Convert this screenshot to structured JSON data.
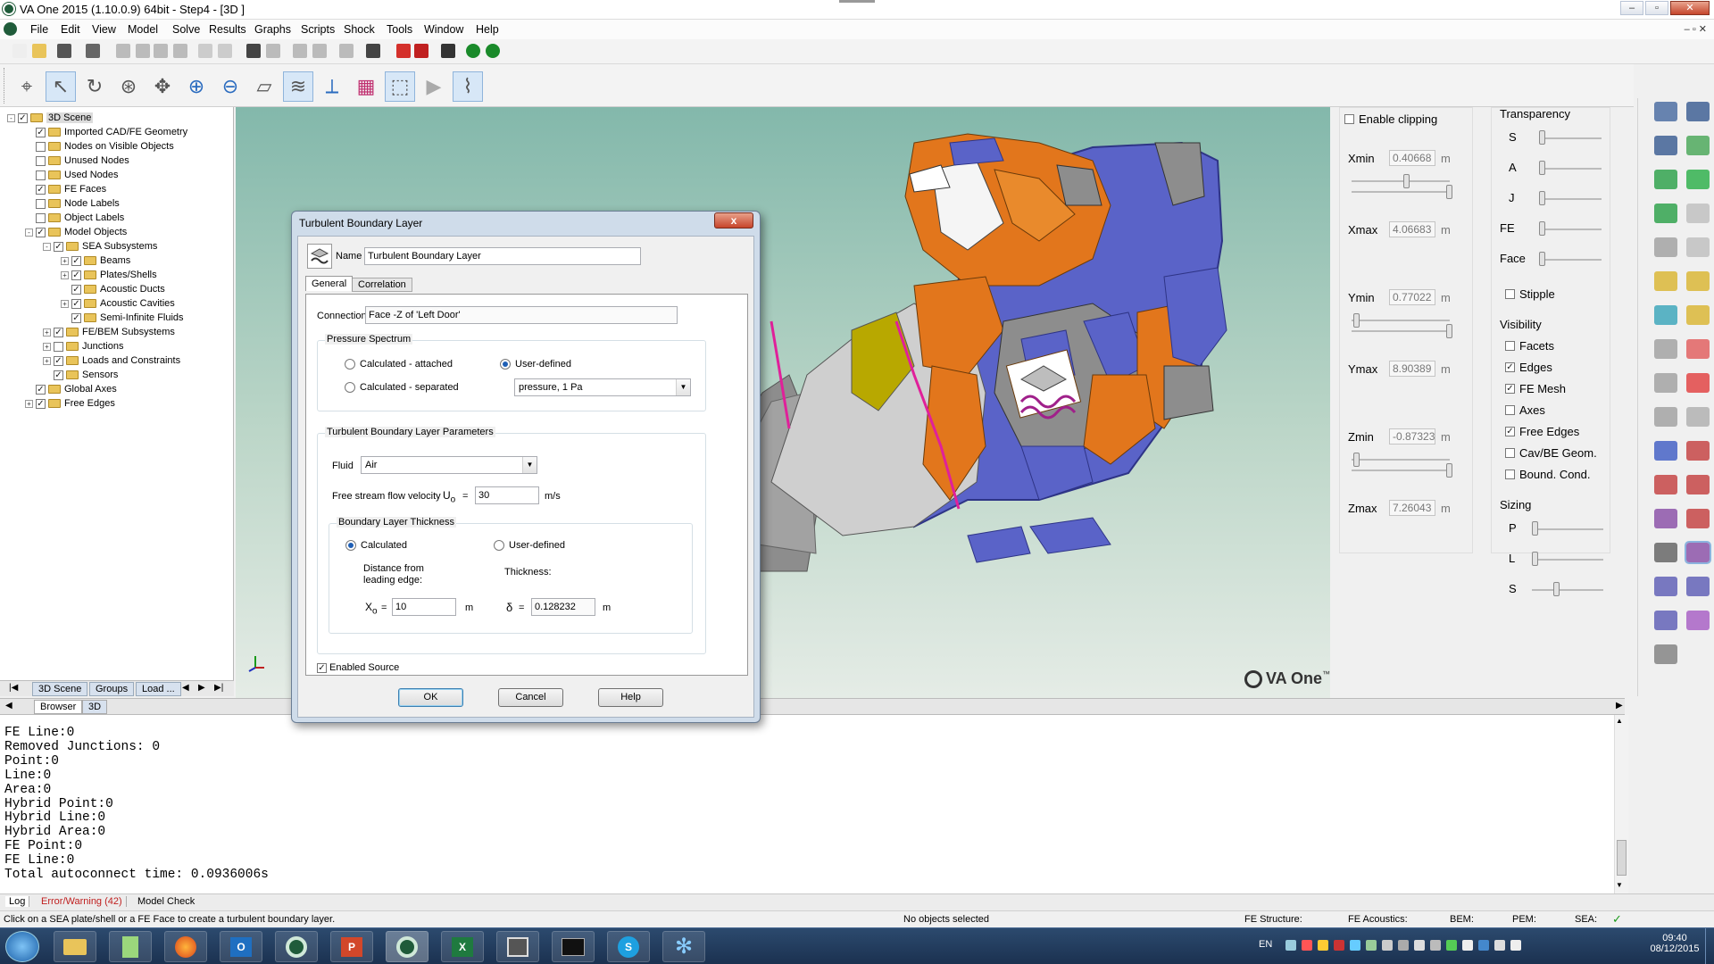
{
  "window": {
    "title": "VA One 2015 (1.10.0.9) 64bit - Step4 - [3D ]"
  },
  "menu": [
    "File",
    "Edit",
    "View",
    "Model",
    "Solve",
    "Results",
    "Graphs",
    "Scripts",
    "Shock",
    "Tools",
    "Window",
    "Help"
  ],
  "tree": {
    "items": [
      {
        "label": "3D Scene",
        "level": 0,
        "checked": true,
        "expand": "-"
      },
      {
        "label": "Imported CAD/FE Geometry",
        "level": 1,
        "checked": true,
        "expand": ""
      },
      {
        "label": "Nodes on Visible Objects",
        "level": 1,
        "checked": false,
        "expand": ""
      },
      {
        "label": "Unused Nodes",
        "level": 1,
        "checked": false,
        "expand": ""
      },
      {
        "label": "Used Nodes",
        "level": 1,
        "checked": false,
        "expand": ""
      },
      {
        "label": "FE Faces",
        "level": 1,
        "checked": true,
        "expand": ""
      },
      {
        "label": "Node Labels",
        "level": 1,
        "checked": false,
        "expand": ""
      },
      {
        "label": "Object Labels",
        "level": 1,
        "checked": false,
        "expand": ""
      },
      {
        "label": "Model Objects",
        "level": 1,
        "checked": true,
        "expand": "-"
      },
      {
        "label": "SEA Subsystems",
        "level": 2,
        "checked": true,
        "expand": "-"
      },
      {
        "label": "Beams",
        "level": 3,
        "checked": true,
        "expand": "+"
      },
      {
        "label": "Plates/Shells",
        "level": 3,
        "checked": true,
        "expand": "+"
      },
      {
        "label": "Acoustic Ducts",
        "level": 3,
        "checked": true,
        "expand": ""
      },
      {
        "label": "Acoustic Cavities",
        "level": 3,
        "checked": true,
        "expand": "+"
      },
      {
        "label": "Semi-Infinite Fluids",
        "level": 3,
        "checked": true,
        "expand": ""
      },
      {
        "label": "FE/BEM Subsystems",
        "level": 2,
        "checked": true,
        "expand": "+"
      },
      {
        "label": "Junctions",
        "level": 2,
        "checked": false,
        "expand": "+"
      },
      {
        "label": "Loads and Constraints",
        "level": 2,
        "checked": true,
        "expand": "+"
      },
      {
        "label": "Sensors",
        "level": 2,
        "checked": true,
        "expand": ""
      },
      {
        "label": "Global Axes",
        "level": 1,
        "checked": true,
        "expand": ""
      },
      {
        "label": "Free Edges",
        "level": 1,
        "checked": true,
        "expand": "+"
      }
    ],
    "tabs": [
      "3D Scene",
      "Groups",
      "Load ..."
    ]
  },
  "clipping": {
    "enable_label": "Enable clipping",
    "fields": [
      {
        "label": "Xmin",
        "value": "0.40668",
        "unit": "m"
      },
      {
        "label": "Xmax",
        "value": "4.06683",
        "unit": "m"
      },
      {
        "label": "Ymin",
        "value": "0.77022",
        "unit": "m"
      },
      {
        "label": "Ymax",
        "value": "8.90389",
        "unit": "m"
      },
      {
        "label": "Zmin",
        "value": "-0.87323",
        "unit": "m"
      },
      {
        "label": "Zmax",
        "value": "7.26043",
        "unit": "m"
      }
    ]
  },
  "transparency": {
    "title": "Transparency",
    "items": [
      "S",
      "A",
      "J",
      "FE",
      "Face"
    ],
    "stipple": "Stipple"
  },
  "visibility": {
    "title": "Visibility",
    "items": [
      {
        "label": "Facets",
        "checked": false
      },
      {
        "label": "Edges",
        "checked": true
      },
      {
        "label": "FE Mesh",
        "checked": true
      },
      {
        "label": "Axes",
        "checked": false
      },
      {
        "label": "Free Edges",
        "checked": true
      },
      {
        "label": "Cav/BE Geom.",
        "checked": false
      },
      {
        "label": "Bound. Cond.",
        "checked": false
      }
    ]
  },
  "sizing": {
    "title": "Sizing",
    "items": [
      "P",
      "L",
      "S"
    ]
  },
  "logo": {
    "text": "VA One",
    "tm": "™"
  },
  "dialog": {
    "title": "Turbulent Boundary Layer",
    "close": "x",
    "name_label": "Name",
    "name_value": "Turbulent Boundary Layer",
    "tabs": [
      "General",
      "Correlation"
    ],
    "connection_label": "Connection",
    "connection_value": "Face -Z of 'Left Door'",
    "pressure_group": "Pressure Spectrum",
    "opt_attached": "Calculated - attached",
    "opt_separated": "Calculated - separated",
    "opt_user": "User-defined",
    "spectrum_value": "pressure, 1 Pa",
    "tbl_group": "Turbulent Boundary Layer Parameters",
    "fluid_label": "Fluid",
    "fluid_value": "Air",
    "velocity_label": "Free stream flow velocity",
    "velocity_symbol": "U",
    "velocity_sub": "o",
    "eq": "=",
    "velocity_value": "30",
    "velocity_unit": "m/s",
    "thickness_group": "Boundary Layer Thickness",
    "th_calc": "Calculated",
    "th_user": "User-defined",
    "distance_label_1": "Distance from",
    "distance_label_2": "leading edge:",
    "thickness_label": "Thickness:",
    "x_symbol": "X",
    "x_sub": "o",
    "x_value": "10",
    "x_unit": "m",
    "delta_symbol": "δ",
    "delta_value": "0.128232",
    "delta_unit": "m",
    "enabled_label": "Enabled Source",
    "ok": "OK",
    "cancel": "Cancel",
    "help": "Help"
  },
  "midtabs": [
    "Browser",
    "3D"
  ],
  "log": {
    "lines": [
      "FE Line:0",
      "Removed Junctions: 0",
      "Point:0",
      "Line:0",
      "Area:0",
      "Hybrid Point:0",
      "Hybrid Line:0",
      "Hybrid Area:0",
      "FE Point:0",
      "FE Line:0",
      "Total autoconnect time: 0.0936006s"
    ],
    "tabs": [
      "Log",
      "Error/Warning (42)",
      "Model Check"
    ]
  },
  "status": {
    "hint": "Click on a SEA plate/shell or a FE Face to create a turbulent boundary layer.",
    "selection": "No objects selected",
    "fe_structure": "FE Structure:",
    "fe_acoustics": "FE Acoustics:",
    "bem": "BEM:",
    "pem": "PEM:",
    "sea": "SEA:",
    "check": "✓"
  },
  "taskbar": {
    "lang": "EN",
    "time": "09:40",
    "date": "08/12/2015"
  },
  "colors": {
    "accent": "#3c7fb1",
    "model_blue": "#5a63c8",
    "model_orange": "#e2761c",
    "model_grey": "#8d8d8d"
  }
}
